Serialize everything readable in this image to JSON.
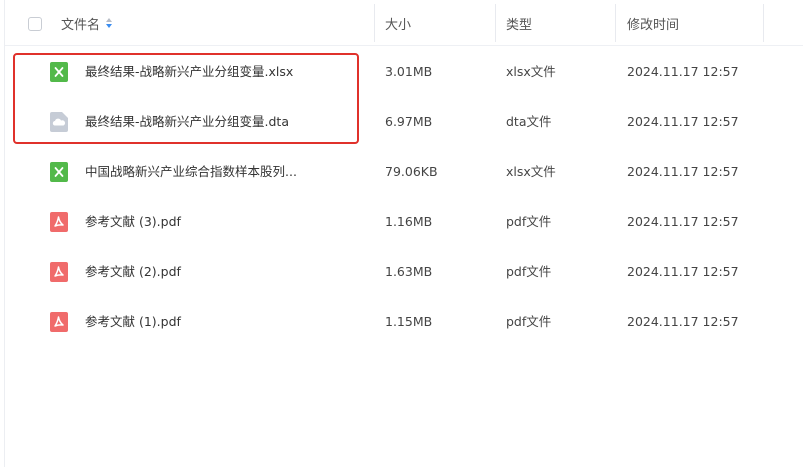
{
  "header": {
    "name": "文件名",
    "size": "大小",
    "type": "类型",
    "modified": "修改时间"
  },
  "files": [
    {
      "name": "最终结果-战略新兴产业分组变量.xlsx",
      "size": "3.01MB",
      "type": "xlsx文件",
      "time": "2024.11.17 12:57",
      "icon": "excel-file-icon"
    },
    {
      "name": "最终结果-战略新兴产业分组变量.dta",
      "size": "6.97MB",
      "type": "dta文件",
      "time": "2024.11.17 12:57",
      "icon": "cloud-file-icon"
    },
    {
      "name": "中国战略新兴产业综合指数样本股列...",
      "size": "79.06KB",
      "type": "xlsx文件",
      "time": "2024.11.17 12:57",
      "icon": "excel-file-icon"
    },
    {
      "name": "参考文献 (3).pdf",
      "size": "1.16MB",
      "type": "pdf文件",
      "time": "2024.11.17 12:57",
      "icon": "pdf-file-icon"
    },
    {
      "name": "参考文献 (2).pdf",
      "size": "1.63MB",
      "type": "pdf文件",
      "time": "2024.11.17 12:57",
      "icon": "pdf-file-icon"
    },
    {
      "name": "参考文献 (1).pdf",
      "size": "1.15MB",
      "type": "pdf文件",
      "time": "2024.11.17 12:57",
      "icon": "pdf-file-icon"
    }
  ],
  "colors": {
    "excel": "#52b94a",
    "dta": "#c6ccd6",
    "pdf": "#f06b6b",
    "highlight": "#e0312b",
    "sort_active": "#3a8cf0"
  }
}
